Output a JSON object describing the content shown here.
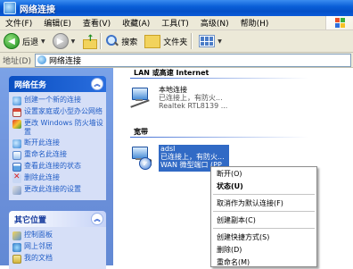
{
  "window": {
    "title": "网络连接"
  },
  "menu": {
    "items": [
      "文件(F)",
      "编辑(E)",
      "查看(V)",
      "收藏(A)",
      "工具(T)",
      "高级(N)",
      "帮助(H)"
    ]
  },
  "toolbar": {
    "back_label": "后退",
    "search_label": "搜索",
    "folders_label": "文件夹"
  },
  "address": {
    "label": "地址(D)",
    "value": "网络连接"
  },
  "tasks": {
    "network_tasks": {
      "title": "网络任务",
      "items": [
        {
          "label": "创建一个新的连接",
          "icon": "new-connection-icon"
        },
        {
          "label": "设置家庭或小型办公网络",
          "icon": "home-network-icon"
        },
        {
          "label": "更改 Windows 防火墙设置",
          "icon": "firewall-icon"
        },
        {
          "label": "断开此连接",
          "icon": "disconnect-icon"
        },
        {
          "label": "重命名此连接",
          "icon": "rename-icon"
        },
        {
          "label": "查看此连接的状态",
          "icon": "status-icon"
        },
        {
          "label": "删除此连接",
          "icon": "delete-icon"
        },
        {
          "label": "更改此连接的设置",
          "icon": "settings-icon"
        }
      ]
    },
    "other_places": {
      "title": "其它位置",
      "items": [
        {
          "label": "控制面板",
          "icon": "control-panel-icon"
        },
        {
          "label": "网上邻居",
          "icon": "network-places-icon"
        },
        {
          "label": "我的文档",
          "icon": "my-documents-icon"
        }
      ]
    }
  },
  "groups": {
    "lan_header": "LAN 或高速 Internet",
    "broadband_header": "宽带"
  },
  "connections": {
    "local": {
      "name": "本地连接",
      "status": "已连接上，有防火...",
      "device": "Realtek RTL8139 ..."
    },
    "adsl": {
      "name": "adsl",
      "status": "已连接上，有防火...",
      "device": "WAN 微型端口 (PP..."
    }
  },
  "context_menu": {
    "items": [
      {
        "label": "断开(O)",
        "bold": false
      },
      {
        "label": "状态(U)",
        "bold": true
      },
      {
        "sep": true
      },
      {
        "label": "取消作为默认连接(F)",
        "bold": false
      },
      {
        "sep": true
      },
      {
        "label": "创建副本(C)",
        "bold": false
      },
      {
        "sep": true
      },
      {
        "label": "创建快捷方式(S)",
        "bold": false
      },
      {
        "label": "删除(D)",
        "bold": false
      },
      {
        "label": "重命名(M)",
        "bold": false
      }
    ]
  }
}
